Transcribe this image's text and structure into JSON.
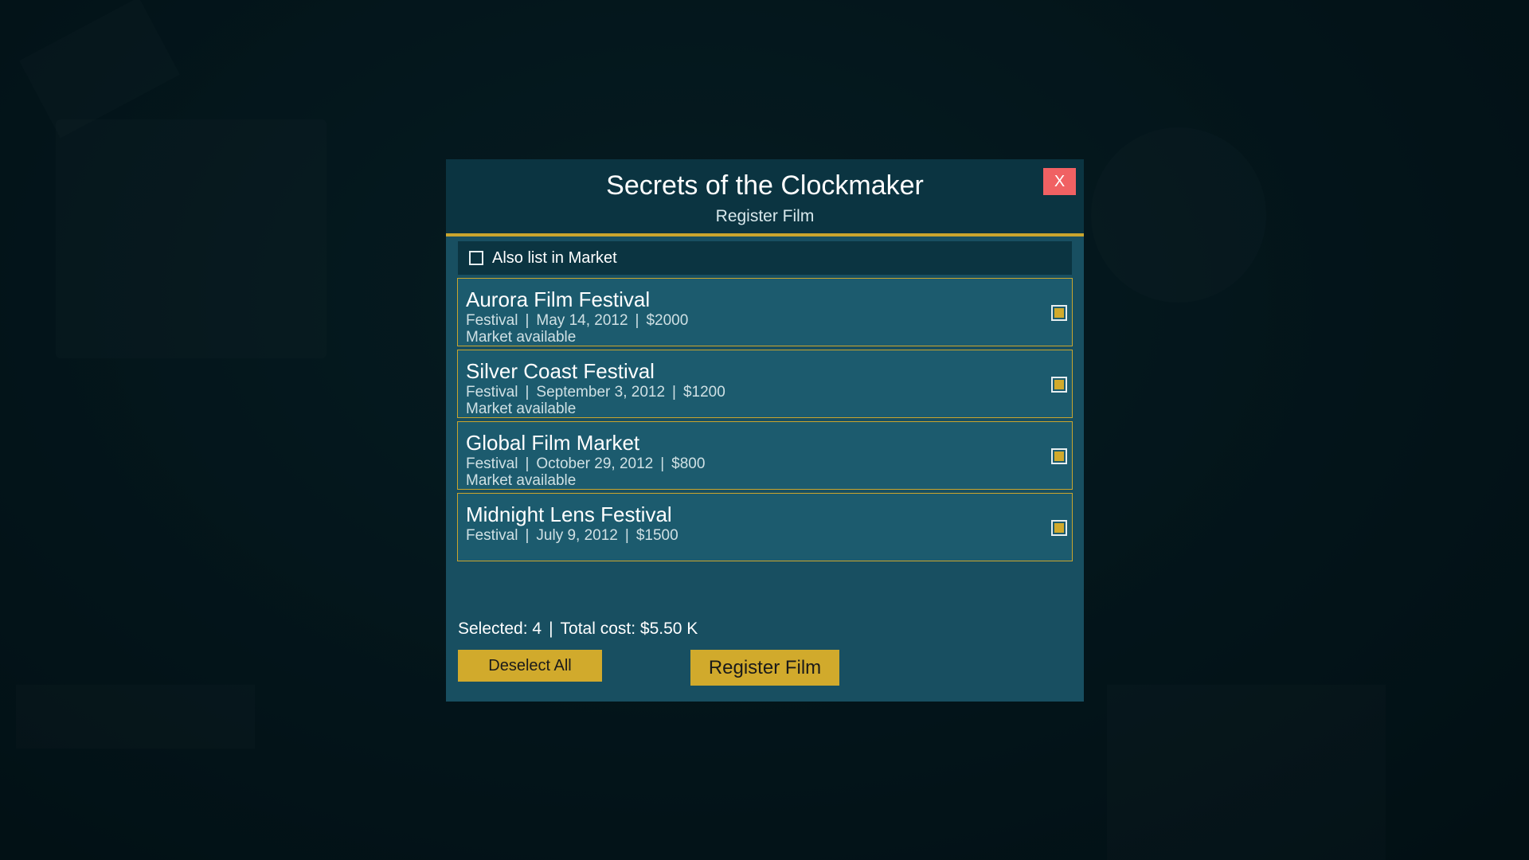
{
  "dialog": {
    "title": "Secrets of the Clockmaker",
    "subtitle": "Register Film",
    "close_label": "X"
  },
  "market_option": {
    "label": "Also list in Market",
    "checked": false
  },
  "festivals": [
    {
      "name": "Aurora Film Festival",
      "type": "Festival",
      "date": "May 14, 2012",
      "cost": "$2000",
      "status": "Market available",
      "selected": true
    },
    {
      "name": "Silver Coast Festival",
      "type": "Festival",
      "date": "September 3, 2012",
      "cost": "$1200",
      "status": "Market available",
      "selected": true
    },
    {
      "name": "Global Film Market",
      "type": "Festival",
      "date": "October 29, 2012",
      "cost": "$800",
      "status": "Market available",
      "selected": true
    },
    {
      "name": "Midnight Lens Festival",
      "type": "Festival",
      "date": "July 9, 2012",
      "cost": "$1500",
      "status": "",
      "selected": true
    }
  ],
  "summary": {
    "selected_text": "Selected: 4",
    "separator": "|",
    "total_text": "Total cost: $5.50 K"
  },
  "buttons": {
    "deselect_label": "Deselect All",
    "register_label": "Register Film"
  },
  "colors": {
    "accent": "#d1aa2c",
    "panel": "#184f61",
    "header": "#0b3441",
    "close": "#f06163"
  }
}
